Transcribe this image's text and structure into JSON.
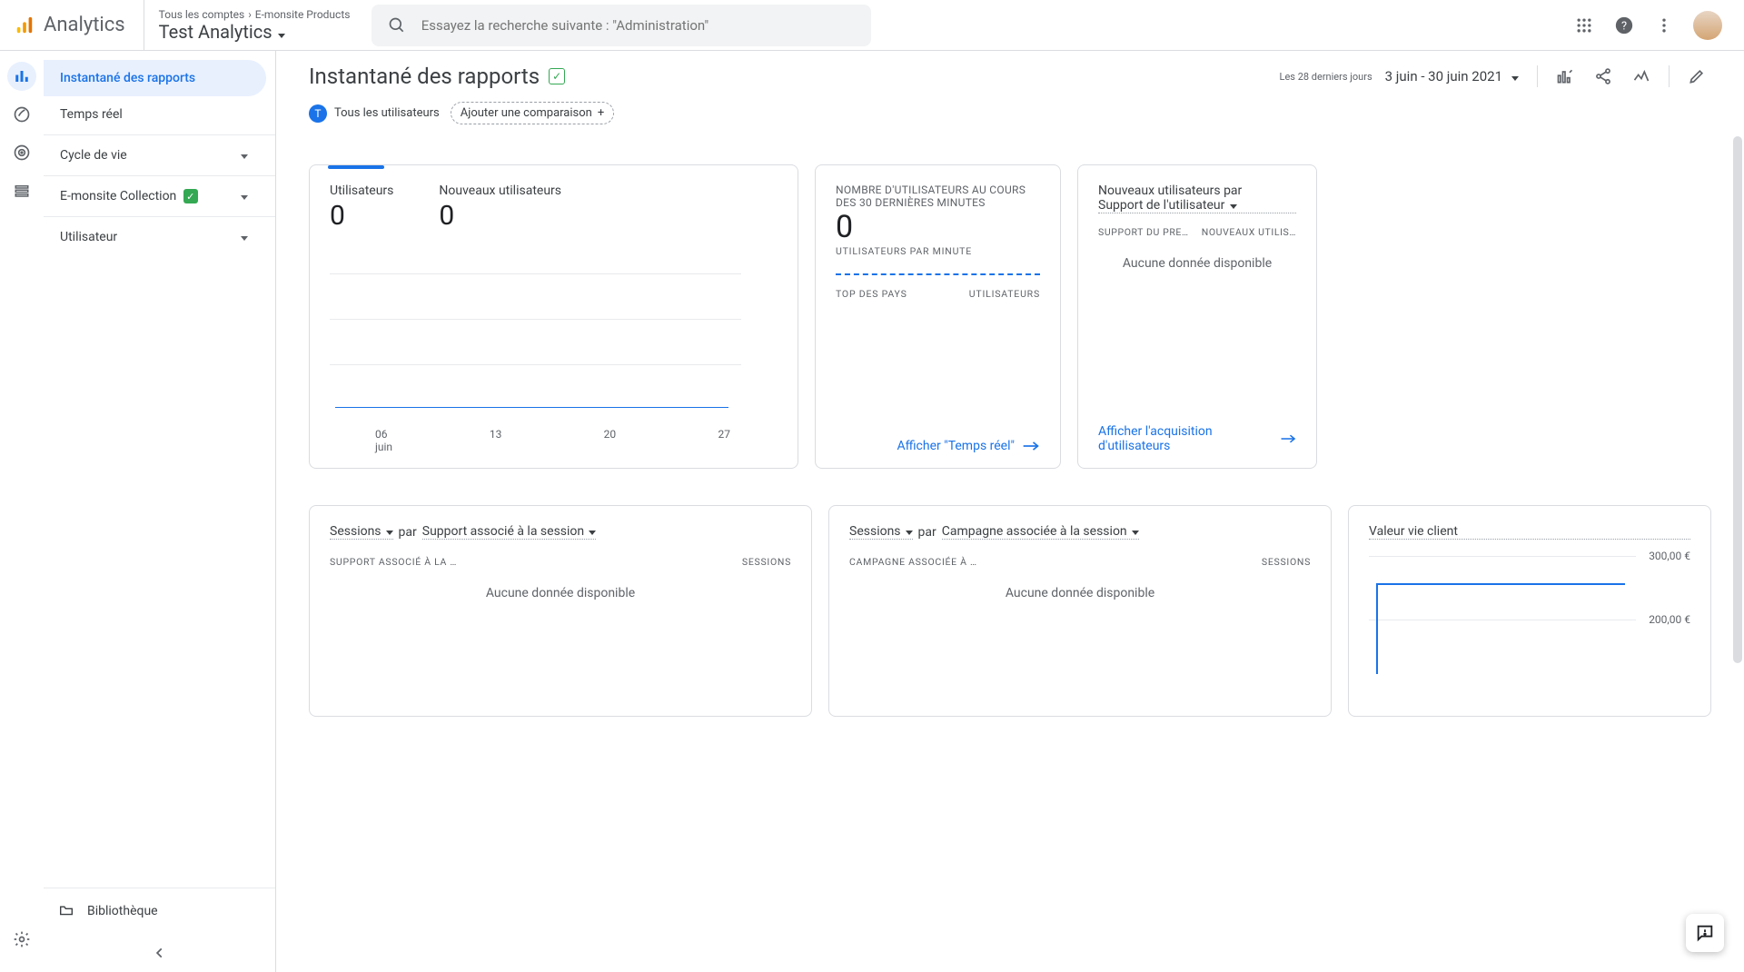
{
  "header": {
    "product": "Analytics",
    "breadcrumb_all": "Tous les comptes",
    "breadcrumb_prop": "E-monsite Products",
    "property_title": "Test Analytics",
    "search_placeholder": "Essayez la recherche suivante : \"Administration\""
  },
  "sidebar": {
    "items": [
      {
        "label": "Instantané des rapports",
        "active": true
      },
      {
        "label": "Temps réel"
      },
      {
        "label": "Cycle de vie",
        "expandable": true
      },
      {
        "label": "E-monsite Collection",
        "expandable": true,
        "badge": "✓"
      },
      {
        "label": "Utilisateur",
        "expandable": true
      }
    ],
    "library": "Bibliothèque"
  },
  "toolbar": {
    "title": "Instantané des rapports",
    "all_users": "Tous les utilisateurs",
    "add_compare": "Ajouter une comparaison",
    "date_label": "Les 28 derniers jours",
    "date_range": "3 juin - 30 juin 2021"
  },
  "cards": {
    "overview": {
      "metric1_label": "Utilisateurs",
      "metric1_value": "0",
      "metric2_label": "Nouveaux utilisateurs",
      "metric2_value": "0",
      "x_ticks": [
        "06",
        "13",
        "20",
        "27"
      ],
      "x_month": "juin"
    },
    "realtime": {
      "heading": "NOMBRE D'UTILISATEURS AU COURS DES 30 DERNIÈRES MINUTES",
      "value": "0",
      "per_minute": "UTILISATEURS PAR MINUTE",
      "top_countries": "TOP DES PAYS",
      "users_col": "UTILISATEURS",
      "link": "Afficher \"Temps réel\""
    },
    "new_users": {
      "title": "Nouveaux utilisateurs par",
      "dimension": "Support de l'utilisateur",
      "col1": "SUPPORT DU PRE…",
      "col2": "NOUVEAUX UTILIS…",
      "no_data": "Aucune donnée disponible",
      "link": "Afficher l'acquisition d'utilisateurs"
    },
    "sessions_medium": {
      "metric": "Sessions",
      "by": "par",
      "dim": "Support associé à la session",
      "col1": "SUPPORT ASSOCIÉ À LA …",
      "col2": "SESSIONS",
      "no_data": "Aucune donnée disponible"
    },
    "sessions_campaign": {
      "metric": "Sessions",
      "by": "par",
      "dim": "Campagne associée à la session",
      "col1": "CAMPAGNE ASSOCIÉE À …",
      "col2": "SESSIONS",
      "no_data": "Aucune donnée disponible"
    },
    "ltv": {
      "title": "Valeur vie client",
      "y_ticks": [
        "300,00 €",
        "200,00 €"
      ]
    }
  },
  "chart_data": [
    {
      "type": "line",
      "title": "Utilisateurs",
      "x": [
        "06",
        "13",
        "20",
        "27"
      ],
      "series": [
        {
          "name": "Utilisateurs",
          "values": [
            0,
            0,
            0,
            0
          ]
        }
      ],
      "xlabel": "juin",
      "ylabel": "",
      "ylim": [
        0,
        1
      ]
    },
    {
      "type": "line",
      "title": "Valeur vie client",
      "series": [
        {
          "name": "Valeur vie client",
          "values": [
            280,
            280
          ]
        }
      ],
      "ylabel": "€",
      "ylim": [
        0,
        300
      ],
      "y_ticks": [
        200,
        300
      ]
    }
  ]
}
